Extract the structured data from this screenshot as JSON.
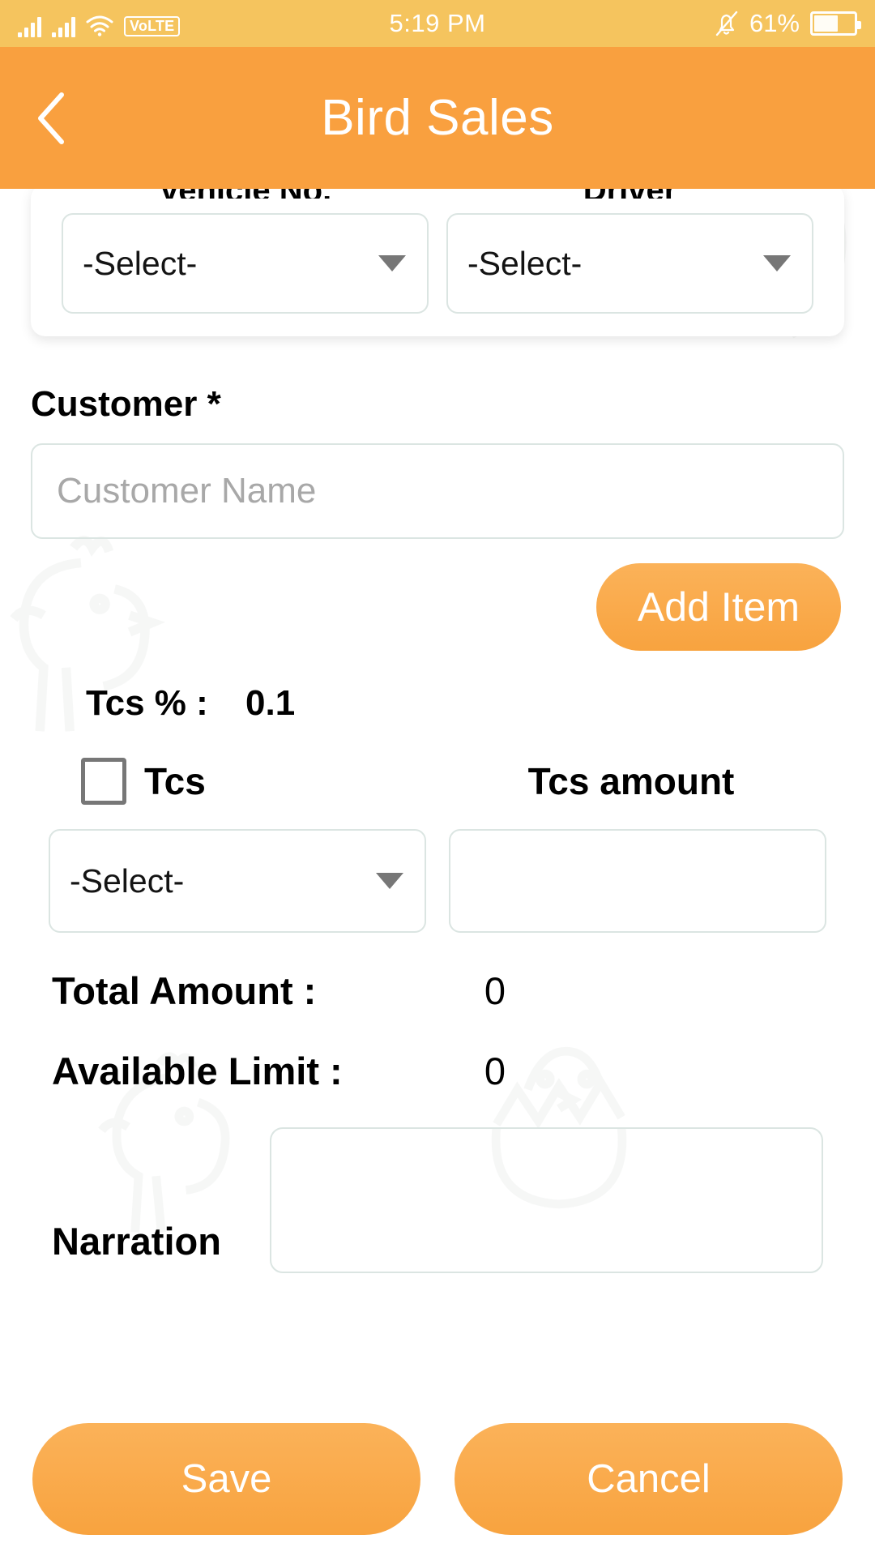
{
  "status_bar": {
    "time": "5:19 PM",
    "battery_percent": "61%",
    "battery_level": 61,
    "volte_label": "VoLTE",
    "icons": [
      "signal-bars-icon",
      "signal-bars-icon",
      "wifi-icon",
      "volte-badge",
      "bell-muted-icon",
      "battery-icon"
    ],
    "background_color": "#f5c45e"
  },
  "header": {
    "title": "Bird Sales",
    "back_icon": "chevron-left-icon",
    "background_color": "#f9a03f",
    "text_color": "#ffffff"
  },
  "form": {
    "vehicle": {
      "label": "Vehicle No.",
      "value": "-Select-"
    },
    "driver": {
      "label": "Driver",
      "value": "-Select-"
    },
    "customer": {
      "label": "Customer *",
      "value": "",
      "placeholder": "Customer Name"
    },
    "add_item_button": "Add Item",
    "tcs_percent": {
      "label": "Tcs % :",
      "value": "0.1"
    },
    "tcs_checkbox": {
      "label": "Tcs",
      "checked": false
    },
    "tcs_amount": {
      "label": "Tcs amount",
      "value": ""
    },
    "tcs_select": {
      "value": "-Select-"
    },
    "total_amount": {
      "label": "Total Amount :",
      "value": "0"
    },
    "available_limit": {
      "label": "Available Limit :",
      "value": "0"
    },
    "narration": {
      "label": "Narration",
      "value": ""
    }
  },
  "actions": {
    "save_label": "Save",
    "cancel_label": "Cancel",
    "accent_color": "#f9a03f"
  }
}
